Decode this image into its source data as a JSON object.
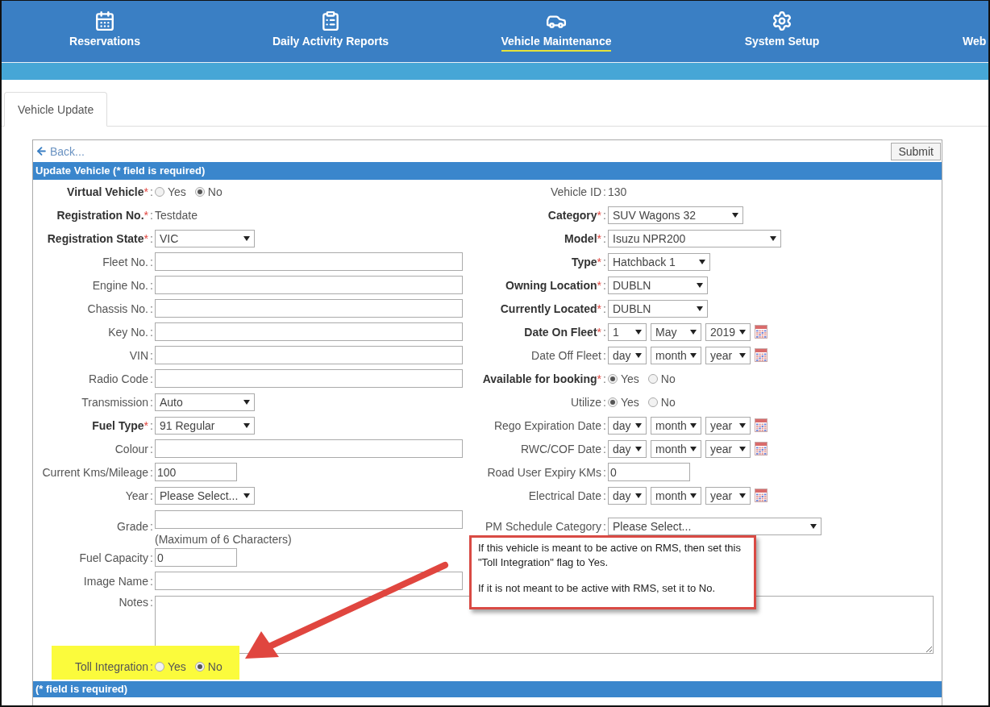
{
  "nav": {
    "items": [
      {
        "label": "Reservations",
        "selected": false
      },
      {
        "label": "Daily Activity Reports",
        "selected": false
      },
      {
        "label": "Vehicle Maintenance",
        "selected": true
      },
      {
        "label": "System Setup",
        "selected": false
      },
      {
        "label": "Web",
        "selected": false
      }
    ]
  },
  "tabs": [
    {
      "label": "Vehicle Update",
      "selected": true
    }
  ],
  "back_link": "Back...",
  "submit_button": "Submit",
  "form": {
    "title": "Update Vehicle (* field is required)",
    "required_mark": "*",
    "separator": ":",
    "rows": [
      {
        "left": {
          "label": "Virtual Vehicle",
          "required": true,
          "kind": "radio",
          "options": [
            {
              "label": "Yes",
              "selected": false
            },
            {
              "label": "No",
              "selected": true
            }
          ]
        },
        "right": {
          "label": "Vehicle ID",
          "required": false,
          "kind": "text",
          "value": "130"
        }
      },
      {
        "left": {
          "label": "Registration No.",
          "required": true,
          "kind": "text",
          "value": "Testdate"
        },
        "right": {
          "label": "Category",
          "required": true,
          "kind": "select",
          "value": "SUV Wagons 32"
        }
      },
      {
        "left": {
          "label": "Registration State",
          "required": true,
          "kind": "select",
          "value": "VIC"
        },
        "right": {
          "label": "Model",
          "required": true,
          "kind": "select",
          "value": "Isuzu NPR200"
        }
      },
      {
        "left": {
          "label": "Fleet No.",
          "required": false,
          "kind": "input"
        },
        "right": {
          "label": "Type",
          "required": true,
          "kind": "select",
          "value": "Hatchback 1"
        }
      },
      {
        "left": {
          "label": "Engine No.",
          "required": false,
          "kind": "input"
        },
        "right": {
          "label": "Owning Location",
          "required": true,
          "kind": "select",
          "value": "DUBLN"
        }
      },
      {
        "left": {
          "label": "Chassis No.",
          "required": false,
          "kind": "input"
        },
        "right": {
          "label": "Currently Located",
          "required": true,
          "kind": "select",
          "value": "DUBLN"
        }
      },
      {
        "left": {
          "label": "Key No.",
          "required": false,
          "kind": "input"
        },
        "right": {
          "label": "Date On Fleet",
          "required": true,
          "kind": "date",
          "parts": [
            "1",
            "May",
            "2019"
          ]
        }
      },
      {
        "left": {
          "label": "VIN",
          "required": false,
          "kind": "input"
        },
        "right": {
          "label": "Date Off Fleet",
          "required": false,
          "kind": "date",
          "parts": [
            "day",
            "month",
            "year"
          ]
        }
      },
      {
        "left": {
          "label": "Radio Code",
          "required": false,
          "kind": "input"
        },
        "right": {
          "label": "Available for booking",
          "required": true,
          "kind": "radio",
          "options": [
            {
              "label": "Yes",
              "selected": true
            },
            {
              "label": "No",
              "selected": false
            }
          ]
        }
      },
      {
        "left": {
          "label": "Transmission",
          "required": false,
          "kind": "select",
          "value": "Auto"
        },
        "right": {
          "label": "Utilize",
          "required": false,
          "kind": "radio",
          "options": [
            {
              "label": "Yes",
              "selected": true
            },
            {
              "label": "No",
              "selected": false
            }
          ]
        }
      },
      {
        "left": {
          "label": "Fuel Type",
          "required": true,
          "kind": "select",
          "value": "91 Regular"
        },
        "right": {
          "label": "Rego Expiration Date",
          "required": false,
          "kind": "date",
          "parts": [
            "day",
            "month",
            "year"
          ]
        }
      },
      {
        "left": {
          "label": "Colour",
          "required": false,
          "kind": "input"
        },
        "right": {
          "label": "RWC/COF Date",
          "required": false,
          "kind": "date",
          "parts": [
            "day",
            "month",
            "year"
          ]
        }
      },
      {
        "left": {
          "label": "Current Kms/Mileage",
          "required": false,
          "kind": "input",
          "value": "100"
        },
        "right": {
          "label": "Road User Expiry KMs",
          "required": false,
          "kind": "input",
          "value": "0"
        }
      },
      {
        "left": {
          "label": "Year",
          "required": false,
          "kind": "select",
          "value": "Please Select..."
        },
        "right": {
          "label": "Electrical Date",
          "required": false,
          "kind": "date",
          "parts": [
            "day",
            "month",
            "year"
          ]
        }
      },
      {
        "left": {
          "label": "Grade",
          "required": false,
          "kind": "input",
          "note": "(Maximum of 6 Characters)"
        },
        "right": {
          "label": "PM Schedule Category",
          "required": false,
          "kind": "select",
          "value": "Please Select..."
        }
      },
      {
        "left": {
          "label": "Fuel Capacity",
          "required": false,
          "kind": "input",
          "value": "0"
        }
      },
      {
        "left": {
          "label": "Image Name",
          "required": false,
          "kind": "input"
        }
      }
    ],
    "notes": {
      "label": "Notes",
      "required": false
    },
    "toll": {
      "label": "Toll Integration",
      "required": false,
      "highlighted": true,
      "options": [
        {
          "label": "Yes",
          "selected": false
        },
        {
          "label": "No",
          "selected": true
        }
      ]
    },
    "footer": "(* field is required)"
  },
  "callout": {
    "paragraphs": [
      "If this vehicle is meant to be active on RMS, then set this \"Toll Integration\" flag to Yes.",
      "If it is not meant to be active with RMS, set it to No."
    ]
  }
}
